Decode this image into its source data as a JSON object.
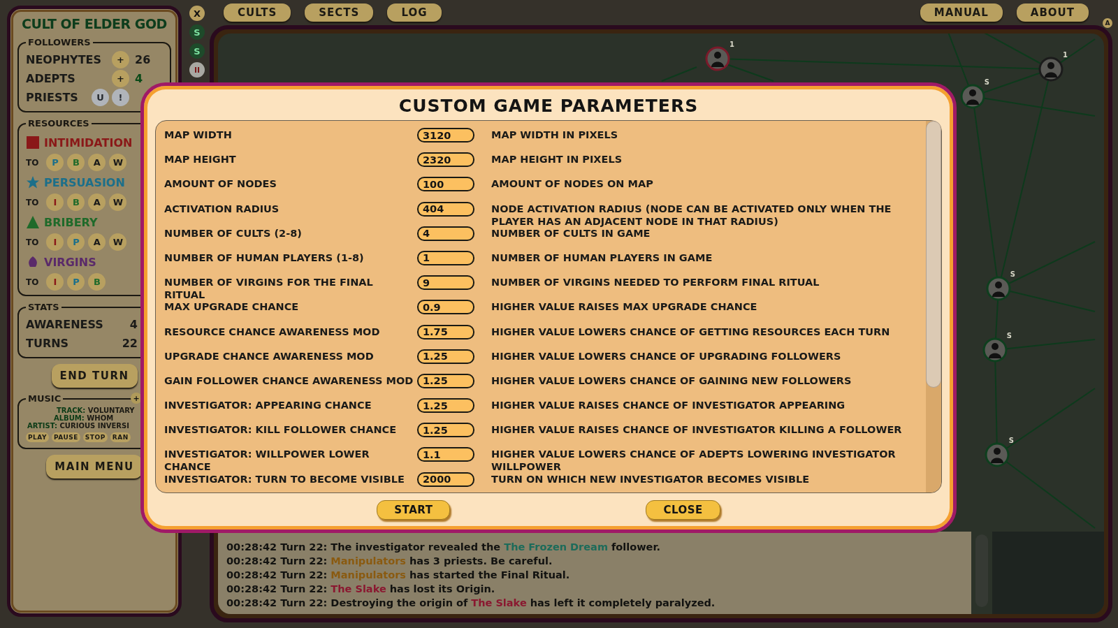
{
  "sidebar": {
    "title": "CULT OF ELDER GOD",
    "followers": {
      "legend": "FOLLOWERS",
      "rows": [
        {
          "label": "NEOPHYTES",
          "buttons": [
            "+"
          ],
          "value": "26",
          "kind": "plain"
        },
        {
          "label": "ADEPTS",
          "buttons": [
            "+"
          ],
          "value": "4",
          "kind": "good"
        },
        {
          "label": "PRIESTS",
          "buttons": [
            "U",
            "!"
          ]
        }
      ]
    },
    "resources": {
      "legend": "RESOURCES",
      "items": [
        {
          "name": "INTIMIDATION",
          "kind": "square",
          "color": "#8a1818",
          "to_label": "TO",
          "conversions": [
            {
              "letter": "P",
              "color": "#1c6f8a"
            },
            {
              "letter": "B",
              "color": "#1f6a2a"
            },
            {
              "letter": "A",
              "color": "#1a1a1a"
            },
            {
              "letter": "W",
              "color": "#1a1a1a"
            }
          ]
        },
        {
          "name": "PERSUASION",
          "kind": "star",
          "color": "#1c6f8a",
          "to_label": "TO",
          "conversions": [
            {
              "letter": "I",
              "color": "#8a1818"
            },
            {
              "letter": "B",
              "color": "#1f6a2a"
            },
            {
              "letter": "A",
              "color": "#1a1a1a"
            },
            {
              "letter": "W",
              "color": "#1a1a1a"
            }
          ]
        },
        {
          "name": "BRIBERY",
          "kind": "triangle",
          "color": "#1f6a2a",
          "to_label": "TO",
          "conversions": [
            {
              "letter": "I",
              "color": "#8a1818"
            },
            {
              "letter": "P",
              "color": "#1c6f8a"
            },
            {
              "letter": "A",
              "color": "#1a1a1a"
            },
            {
              "letter": "W",
              "color": "#1a1a1a"
            }
          ]
        },
        {
          "name": "VIRGINS",
          "kind": "flower",
          "color": "#5a2a6a",
          "to_label": "TO",
          "conversions": [
            {
              "letter": "I",
              "color": "#8a1818"
            },
            {
              "letter": "P",
              "color": "#1c6f8a"
            },
            {
              "letter": "B",
              "color": "#1f6a2a"
            }
          ]
        }
      ]
    },
    "stats": {
      "legend": "STATS",
      "rows": [
        {
          "label": "AWARENESS",
          "value": "4"
        },
        {
          "label": "TURNS",
          "value": "22"
        }
      ]
    },
    "end_turn": "END TURN",
    "music": {
      "legend": "MUSIC",
      "add": "+",
      "lines": [
        {
          "key": "TRACK:",
          "value": "VOLUNTARY"
        },
        {
          "key": "ALBUM:",
          "value": "WHOM"
        },
        {
          "key": "ARTIST:",
          "value": "CURIOUS INVERSI"
        }
      ],
      "buttons": [
        "PLAY",
        "PAUSE",
        "STOP",
        "RAN"
      ]
    },
    "main_menu": "MAIN MENU"
  },
  "side_buttons": [
    {
      "label": "X",
      "kind": "close"
    },
    {
      "label": "S",
      "kind": "green"
    },
    {
      "label": "S",
      "kind": "green"
    },
    {
      "label": "II",
      "kind": "pause"
    }
  ],
  "top_nav": {
    "left": [
      "CULTS",
      "SECTS",
      "LOG"
    ],
    "right": [
      "MANUAL",
      "ABOUT"
    ],
    "corner": "A"
  },
  "map": {
    "nodes": [
      {
        "label": "1",
        "color": "#7a1a2a"
      },
      {
        "label": "1",
        "color": "#1b1b1b"
      },
      {
        "label": "S",
        "color": "#0e3f1e"
      },
      {
        "label": "S",
        "color": "#0e3f1e"
      },
      {
        "label": "S",
        "color": "#0e3f1e"
      },
      {
        "label": "S",
        "color": "#0e3f1e"
      }
    ]
  },
  "log": [
    {
      "parts": [
        {
          "t": "00:28:42 Turn 22: The investigator revealed the "
        },
        {
          "t": "The Frozen Dream",
          "color": "#1d6b5a"
        },
        {
          "t": " follower."
        }
      ]
    },
    {
      "parts": [
        {
          "t": "00:28:42 Turn 22: "
        },
        {
          "t": "Manipulators",
          "color": "#8a5a10"
        },
        {
          "t": " has 3 priests. Be careful."
        }
      ]
    },
    {
      "parts": [
        {
          "t": "00:28:42 Turn 22: "
        },
        {
          "t": "Manipulators",
          "color": "#8a5a10"
        },
        {
          "t": " has started the Final Ritual."
        }
      ]
    },
    {
      "parts": [
        {
          "t": "00:28:42 Turn 22: "
        },
        {
          "t": "The Slake",
          "color": "#8a1830"
        },
        {
          "t": " has lost its Origin."
        }
      ]
    },
    {
      "parts": [
        {
          "t": "00:28:42 Turn 22: Destroying the origin of "
        },
        {
          "t": "The Slake",
          "color": "#8a1830"
        },
        {
          "t": " has left it completely paralyzed."
        }
      ]
    }
  ],
  "dialog": {
    "title": "CUSTOM GAME PARAMETERS",
    "params": [
      {
        "label": "MAP WIDTH",
        "value": "3120",
        "description": "MAP WIDTH IN PIXELS"
      },
      {
        "label": "MAP HEIGHT",
        "value": "2320",
        "description": "MAP HEIGHT IN PIXELS"
      },
      {
        "label": "AMOUNT OF NODES",
        "value": "100",
        "description": "AMOUNT OF NODES ON MAP"
      },
      {
        "label": "ACTIVATION RADIUS",
        "value": "404",
        "description": "NODE ACTIVATION RADIUS (NODE CAN BE ACTIVATED ONLY WHEN THE PLAYER HAS AN ADJACENT NODE IN THAT RADIUS)"
      },
      {
        "label": "NUMBER OF CULTS (2-8)",
        "value": "4",
        "description": "NUMBER OF CULTS IN GAME"
      },
      {
        "label": "NUMBER OF HUMAN PLAYERS (1-8)",
        "value": "1",
        "description": "NUMBER OF HUMAN PLAYERS IN GAME"
      },
      {
        "label": "NUMBER OF VIRGINS FOR THE FINAL RITUAL",
        "value": "9",
        "description": "NUMBER OF VIRGINS NEEDED TO PERFORM FINAL RITUAL"
      },
      {
        "label": "MAX UPGRADE CHANCE",
        "value": "0.9",
        "description": "HIGHER VALUE RAISES MAX UPGRADE CHANCE"
      },
      {
        "label": "RESOURCE CHANCE AWARENESS MOD",
        "value": "1.75",
        "description": "HIGHER VALUE LOWERS CHANCE OF GETTING RESOURCES EACH TURN"
      },
      {
        "label": "UPGRADE CHANCE AWARENESS MOD",
        "value": "1.25",
        "description": "HIGHER VALUE LOWERS CHANCE OF UPGRADING FOLLOWERS"
      },
      {
        "label": "GAIN FOLLOWER CHANCE AWARENESS MOD",
        "value": "1.25",
        "description": "HIGHER VALUE LOWERS CHANCE OF GAINING NEW FOLLOWERS"
      },
      {
        "label": "INVESTIGATOR: APPEARING CHANCE",
        "value": "1.25",
        "description": "HIGHER VALUE RAISES CHANCE OF INVESTIGATOR APPEARING"
      },
      {
        "label": "INVESTIGATOR: KILL FOLLOWER CHANCE",
        "value": "1.25",
        "description": "HIGHER VALUE RAISES CHANCE OF INVESTIGATOR KILLING A FOLLOWER"
      },
      {
        "label": "INVESTIGATOR: WILLPOWER LOWER CHANCE",
        "value": "1.1",
        "description": "HIGHER VALUE LOWERS CHANCE OF ADEPTS LOWERING INVESTIGATOR WILLPOWER"
      },
      {
        "label": "INVESTIGATOR: TURN TO BECOME VISIBLE",
        "value": "2000",
        "description": "TURN ON WHICH NEW INVESTIGATOR BECOMES VISIBLE"
      }
    ],
    "buttons": [
      "START",
      "CLOSE"
    ]
  }
}
